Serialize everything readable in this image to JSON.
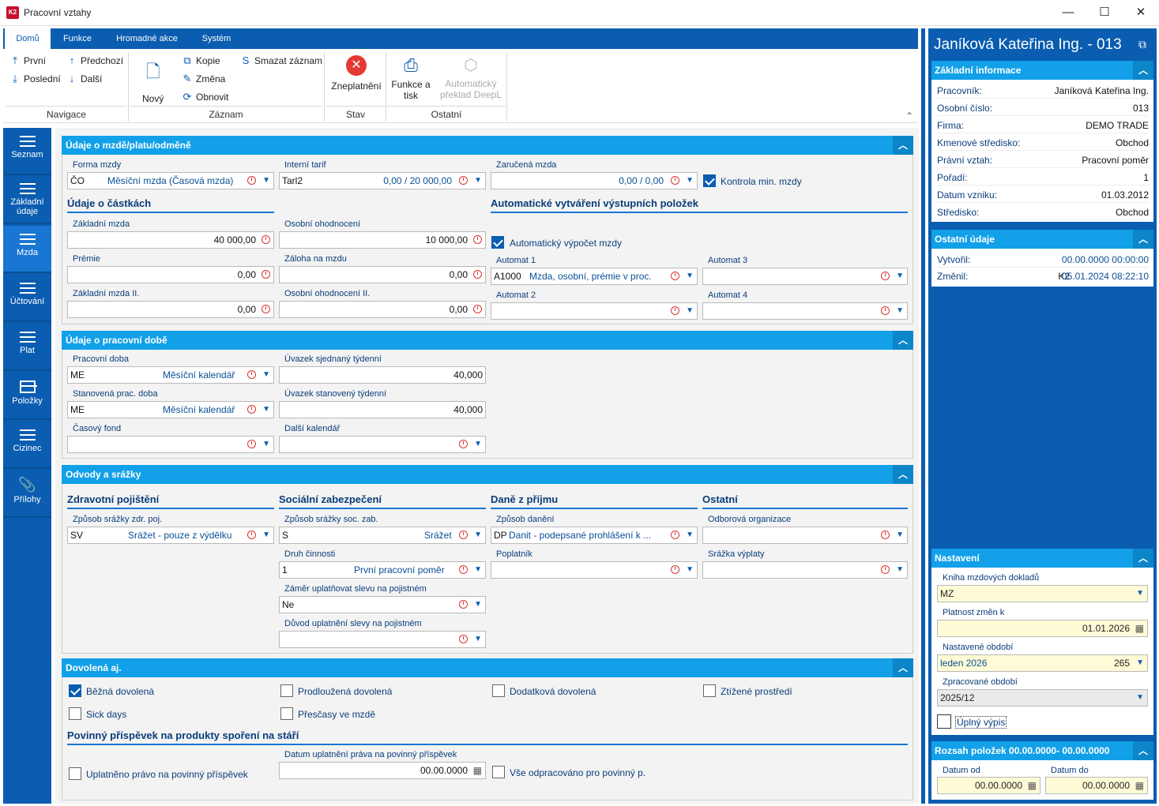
{
  "window": {
    "title": "Pracovní vztahy",
    "logo": "K2",
    "minimize": "—",
    "maximize": "☐",
    "close": "✕"
  },
  "ribbon": {
    "tabs": [
      "Domů",
      "Funkce",
      "Hromadné akce",
      "Systém"
    ],
    "nav": {
      "first": "První",
      "prev": "Předchozí",
      "last": "Poslední",
      "next": "Další",
      "group": "Navigace"
    },
    "record": {
      "new": "Nový",
      "copy": "Kopie",
      "change": "Změna",
      "refresh": "Obnovit",
      "delete": "Smazat záznam",
      "group": "Záznam"
    },
    "state": {
      "invalidate": "Zneplatnění",
      "group": "Stav"
    },
    "other": {
      "print": "Funkce a tisk",
      "translate": "Automatický překlad DeepL",
      "group": "Ostatní"
    }
  },
  "leftnav": [
    "Seznam",
    "Základní údaje",
    "Mzda",
    "Účtování",
    "Plat",
    "Položky",
    "Cizinec",
    "Přílohy"
  ],
  "s1": {
    "title": "Údaje o mzdě/platu/odměně",
    "forma_lbl": "Forma mzdy",
    "forma_code": "ČO",
    "forma_name": "Měsíční mzda (Časová mzda)",
    "tarif_lbl": "Interní tarif",
    "tarif_code": "Tarl2",
    "tarif_val": "0,00 / 20 000,00",
    "zar_lbl": "Zaručená mzda",
    "zar_val": "0,00 / 0,00",
    "kontrola": "Kontrola min. mzdy",
    "castky_h": "Údaje o částkách",
    "auto_h": "Automatické vytváření výstupních položek",
    "zakl_lbl": "Základní mzda",
    "zakl_val": "40 000,00",
    "oso_lbl": "Osobní ohodnocení",
    "oso_val": "10 000,00",
    "auto_vyp": "Automatický výpočet mzdy",
    "prem_lbl": "Prémie",
    "prem_val": "0,00",
    "zal_lbl": "Záloha na mzdu",
    "zal_val": "0,00",
    "a1_lbl": "Automat 1",
    "a1_code": "A1000",
    "a1_name": "Mzda, osobní, prémie v proc.",
    "a3_lbl": "Automat 3",
    "zakl2_lbl": "Základní mzda II.",
    "zakl2_val": "0,00",
    "oso2_lbl": "Osobní ohodnocení II.",
    "oso2_val": "0,00",
    "a2_lbl": "Automat 2",
    "a4_lbl": "Automat 4"
  },
  "s2": {
    "title": "Údaje o pracovní době",
    "pd_lbl": "Pracovní doba",
    "pd_code": "ME",
    "pd_name": "Měsíční kalendář",
    "uvs_lbl": "Úvazek sjednaný týdenní",
    "uvs_val": "40,000",
    "spd_lbl": "Stanovená prac. doba",
    "spd_code": "ME",
    "spd_name": "Měsíční kalendář",
    "uvst_lbl": "Úvazek stanovený týdenní",
    "uvst_val": "40,000",
    "cf_lbl": "Časový fond",
    "dk_lbl": "Další kalendář"
  },
  "s3": {
    "title": "Odvody a srážky",
    "zp_h": "Zdravotní pojištění",
    "sz_h": "Sociální zabezpečení",
    "dp_h": "Daně z příjmu",
    "ost_h": "Ostatní",
    "zp_lbl": "Způsob srážky zdr. poj.",
    "zp_code": "SV",
    "zp_name": "Srážet - pouze z výdělku",
    "sz_lbl": "Způsob srážky soc. zab.",
    "sz_code": "S",
    "sz_name": "Srážet",
    "dan_lbl": "Způsob danění",
    "dan_code": "DP",
    "dan_name": "Danit - podepsané prohlášení k ...",
    "odb_lbl": "Odborová organizace",
    "dc_lbl": "Druh činnosti",
    "dc_code": "1",
    "dc_name": "První pracovní poměr",
    "popl_lbl": "Poplatník",
    "srv_lbl": "Srážka výplaty",
    "zam_lbl": "Záměr uplatňovat slevu na pojistném",
    "zam_val": "Ne",
    "duv_lbl": "Důvod uplatnění slevy na pojistném"
  },
  "s4": {
    "title": "Dovolená aj.",
    "bezna": "Běžná dovolená",
    "prodl": "Prodloužená dovolená",
    "dodat": "Dodatková dovolená",
    "ztiz": "Ztížené prostředí",
    "sick": "Sick days",
    "presc": "Přesčasy ve mzdě",
    "pp_h": "Povinný příspěvek na produkty spoření na stáří",
    "upl": "Uplatněno právo na povinný příspěvek",
    "dat_lbl": "Datum uplatnění práva na povinný příspěvek",
    "dat_val": "00.00.0000",
    "vse": "Vše odpracováno pro povinný p."
  },
  "right": {
    "title": "Janíková Kateřina Ing. - 013",
    "zakl_h": "Základní informace",
    "rows": [
      {
        "k": "Pracovník:",
        "v": "Janíková Kateřina Ing."
      },
      {
        "k": "Osobní číslo:",
        "v": "013"
      },
      {
        "k": "Firma:",
        "v": "DEMO TRADE"
      },
      {
        "k": "Kmenové středisko:",
        "v": "Obchod"
      },
      {
        "k": "Právní vztah:",
        "v": "Pracovní poměr"
      },
      {
        "k": "Pořadí:",
        "v": "1"
      },
      {
        "k": "Datum vzniku:",
        "v": "01.03.2012"
      },
      {
        "k": "Středisko:",
        "v": "Obchod"
      }
    ],
    "ost_h": "Ostatní údaje",
    "vytvoril_k": "Vytvořil:",
    "vytvoril_v": "00.00.0000 00:00:00",
    "zmenil_k": "Změnil:",
    "zmenil_user": "K2",
    "zmenil_v": "05.01.2024 08:22:10",
    "nast_h": "Nastavení",
    "kniha_lbl": "Kniha mzdových dokladů",
    "kniha_val": "MZ",
    "plat_lbl": "Platnost změn k",
    "plat_val": "01.01.2026",
    "obd_lbl": "Nastavené období",
    "obd_val": "leden 2026",
    "obd_num": "265",
    "zpr_lbl": "Zpracované období",
    "zpr_val": "2025/12",
    "uplny": "Úplný výpis",
    "rozsah_h": "Rozsah položek 00.00.0000- 00.00.0000",
    "od_lbl": "Datum od",
    "od_val": "00.00.0000",
    "do_lbl": "Datum do",
    "do_val": "00.00.0000"
  }
}
